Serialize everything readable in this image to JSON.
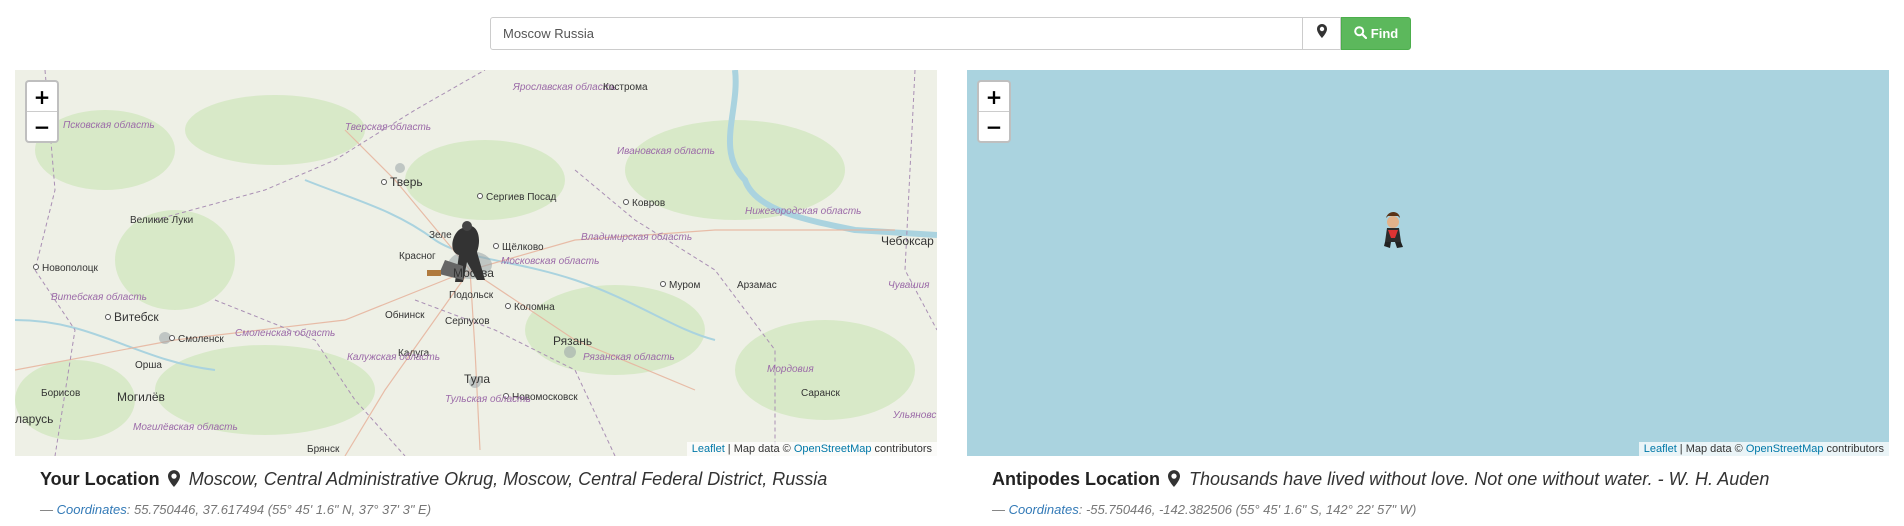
{
  "search": {
    "value": "Moscow Russia",
    "find_label": "Find"
  },
  "icons": {
    "search": "search-icon",
    "location": "map-marker-icon"
  },
  "colors": {
    "find_button": "#5cb85c",
    "land": "#eef0e6",
    "sea": "#aad3df",
    "link": "#337ab7"
  },
  "zoom": {
    "in": "+",
    "out": "−"
  },
  "attribution": {
    "leaflet": "Leaflet",
    "separator": " | Map data © ",
    "osm": "OpenStreetMap",
    "suffix": " contributors"
  },
  "your_location": {
    "label": "Your Location",
    "place": "Moscow, Central Administrative Okrug, Moscow, Central Federal District, Russia",
    "coord_prefix": "— ",
    "coord_link": "Coordinates",
    "coords": ": 55.750446, 37.617494 (55° 45' 1.6\" N, 37° 37' 3\" E)"
  },
  "antipodes_location": {
    "label": "Antipodes Location",
    "place": "Thousands have lived without love. Not one without water. - W. H. Auden",
    "coord_prefix": "— ",
    "coord_link": "Coordinates",
    "coords": ": -55.750446, -142.382506 (55° 45' 1.6\" S, 142° 22' 57\" W)"
  },
  "map_labels": {
    "yaroslavskaya": "Ярославская область",
    "kostroma": "Кострома",
    "pskovskaya": "Псковская область",
    "tverskaya": "Тверская область",
    "ivanovskaya": "Ивановская область",
    "tver": "Тверь",
    "sergiev": "Сергиев Посад",
    "velikie_luki": "Великие Луки",
    "nizhegorodskaya": "Нижегородская область",
    "kovrov": "Ковров",
    "zelen": "Зеле",
    "krasnog": "Красног",
    "shchelkovo": "Щёлково",
    "vladimirskaya": "Владимирская область",
    "cheboksary": "Чебоксар",
    "novopolotsk": "Новополоцк",
    "moskva": "Москва",
    "moskovskaya": "Московская область",
    "murom": "Муром",
    "arzamas": "Арзамас",
    "podolsk": "Подольск",
    "vitebskaya": "Витебская область",
    "chuvashia": "Чувашия",
    "vitebsk": "Витебск",
    "obninsk": "Обнинск",
    "kolomna": "Коломна",
    "serpukhov": "Серпухов",
    "smolensk": "Смоленск",
    "smolenskaya": "Смоленская область",
    "ryazan": "Рязань",
    "kaluga": "Калуга",
    "orsha": "Орша",
    "kaluzhskaya": "Калужская область",
    "ryazanskaya": "Рязанская область",
    "mordovia": "Мордовия",
    "borisov": "Борисов",
    "mogilev": "Могилёв",
    "tula": "Тула",
    "novomoskovsk": "Новомосковск",
    "saransk": "Саранск",
    "tulskaya": "Тульская область",
    "mogilevskaya": "Могилёвская область",
    "ulyanovskaya": "Ульяновс область",
    "belarus": "ларусь",
    "bryansk": "Брянск"
  }
}
